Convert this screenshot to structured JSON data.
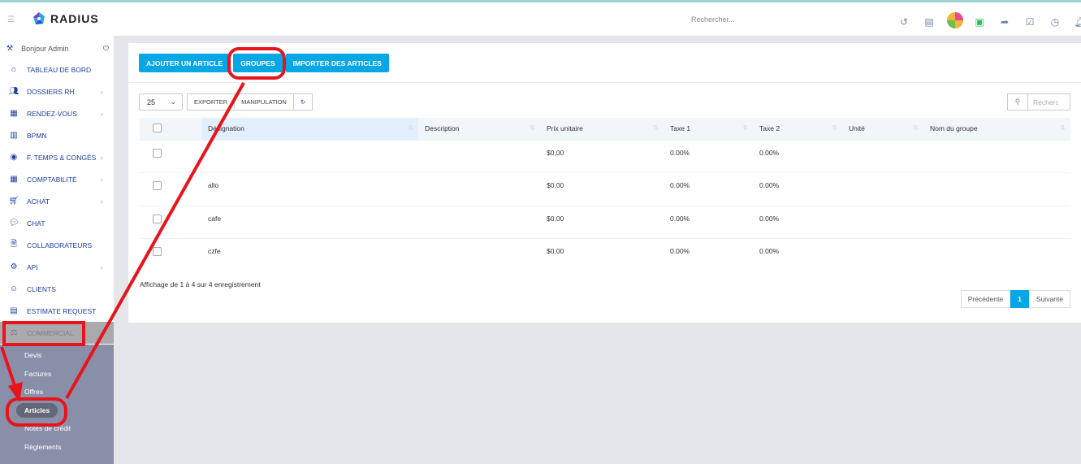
{
  "header": {
    "brand": "RADIUS",
    "search_placeholder": "Rechercher...",
    "icons": [
      "history-icon",
      "id-card-icon",
      "color-wheel-icon",
      "chat-user-icon",
      "share-icon",
      "checkbox-icon",
      "clock-icon",
      "bell-icon"
    ]
  },
  "sidebar": {
    "greeting": "Bonjour Admin",
    "items": [
      {
        "label": "TABLEAU DE BORD",
        "icon": "home-icon"
      },
      {
        "label": "DOSSIERS RH",
        "icon": "users-icon"
      },
      {
        "label": "RENDEZ-VOUS",
        "icon": "calendar-icon"
      },
      {
        "label": "BPMN",
        "icon": "map-icon"
      },
      {
        "label": "F. TEMPS & CONGÉS",
        "icon": "user-circle-icon"
      },
      {
        "label": "COMPTABILITÉ",
        "icon": "calculator-icon"
      },
      {
        "label": "ACHAT",
        "icon": "cart-icon"
      },
      {
        "label": "CHAT",
        "icon": "chat-icon"
      },
      {
        "label": "COLLABORATEURS",
        "icon": "file-icon"
      },
      {
        "label": "API",
        "icon": "cogs-icon"
      },
      {
        "label": "CLIENTS",
        "icon": "user-icon"
      },
      {
        "label": "ESTIMATE REQUEST",
        "icon": "list-icon"
      },
      {
        "label": "COMMERCIAL",
        "icon": "scale-icon"
      }
    ],
    "submenu": [
      "Devis",
      "Factures",
      "Offres",
      "Articles",
      "Notes de crédit",
      "Règlements"
    ]
  },
  "main": {
    "buttons": {
      "add": "AJOUTER UN ARTICLE",
      "groups": "GROUPES",
      "import": "IMPORTER DES ARTICLES"
    },
    "page_size": "25",
    "export": "EXPORTER",
    "manipulation": "MANIPULATION",
    "search_placeholder": "Recherc",
    "columns": [
      "Désignation",
      "Description",
      "Prix unitaire",
      "Taxe 1",
      "Taxe 2",
      "Unité",
      "Nom du groupe"
    ],
    "rows": [
      [
        "",
        "",
        "$0,00",
        "0.00%",
        "0.00%",
        "",
        ""
      ],
      [
        "allo",
        "",
        "$0,00",
        "0.00%",
        "0.00%",
        "",
        ""
      ],
      [
        "cafe",
        "",
        "$0,00",
        "0.00%",
        "0.00%",
        "",
        ""
      ],
      [
        "czfe",
        "",
        "$0,00",
        "0.00%",
        "0.00%",
        "",
        ""
      ]
    ],
    "info": "Affichage de 1 à 4 sur 4 enregistrement",
    "pagination": {
      "prev": "Précédente",
      "current": "1",
      "next": "Suivante"
    }
  },
  "colors": {
    "accent": "#07a7e6",
    "annotation": "#e8141c",
    "submenu_bg": "#8a8fa9"
  }
}
